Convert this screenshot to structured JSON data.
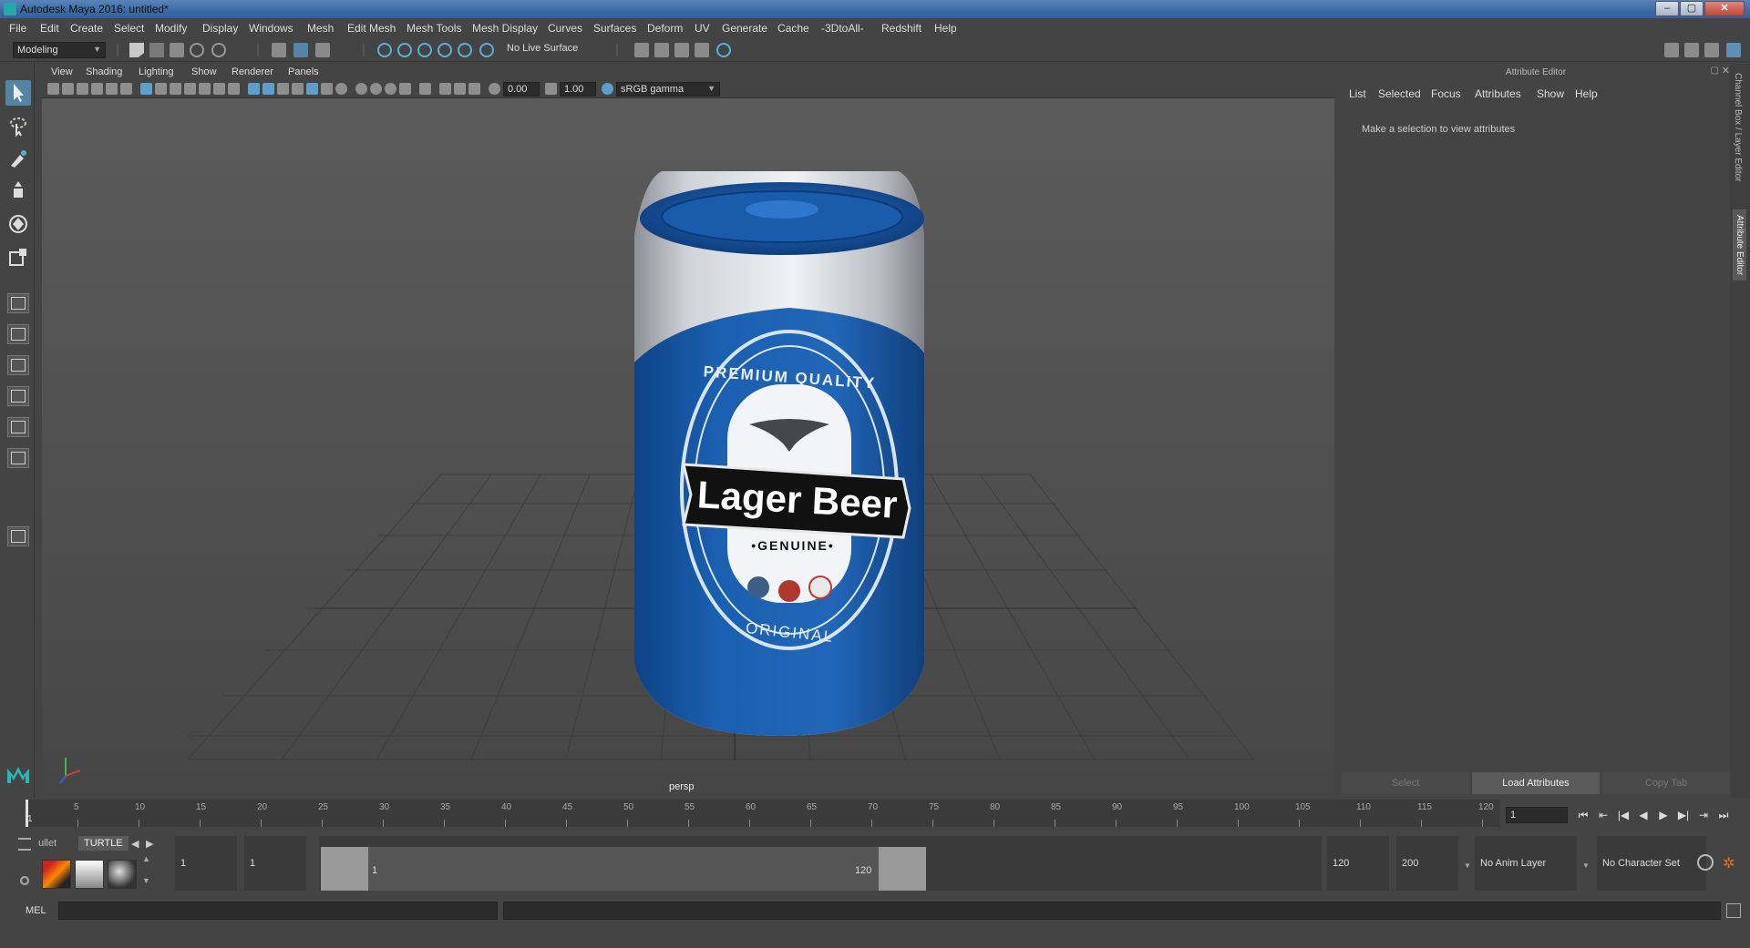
{
  "window": {
    "title": "Autodesk Maya 2016: untitled*",
    "controls": [
      "–",
      "▢",
      "✕"
    ]
  },
  "menubar": [
    "File",
    "Edit",
    "Create",
    "Select",
    "Modify",
    "Display",
    "Windows",
    "Mesh",
    "Edit Mesh",
    "Mesh Tools",
    "Mesh Display",
    "Curves",
    "Surfaces",
    "Deform",
    "UV",
    "Generate",
    "Cache",
    "-3DtoAll-",
    "Redshift",
    "Help"
  ],
  "statusline": {
    "mode": "Modeling",
    "live_surface": "No Live Surface"
  },
  "viewport": {
    "menu": [
      "View",
      "Shading",
      "Lighting",
      "Show",
      "Renderer",
      "Panels"
    ],
    "exposure": "0.00",
    "gamma": "1.00",
    "color_space": "sRGB gamma",
    "camera": "persp",
    "can": {
      "top_text": "PREMIUM QUALITY",
      "brand": "Lager Beer",
      "sub": "•GENUINE•",
      "bottom_text": "ORIGINAL",
      "colors": {
        "blue": "#1b5fb0",
        "silver": "#c9cdd2"
      }
    }
  },
  "attribute_editor": {
    "title": "Attribute Editor",
    "menu": [
      "List",
      "Selected",
      "Focus",
      "Attributes",
      "Show",
      "Help"
    ],
    "message": "Make a selection to view attributes",
    "buttons": {
      "select": "Select",
      "load": "Load Attributes",
      "copy": "Copy Tab"
    },
    "side_tabs": [
      "Channel Box / Layer Editor",
      "Attribute Editor"
    ]
  },
  "timeslider": {
    "ticks": [
      "5",
      "10",
      "15",
      "20",
      "25",
      "30",
      "35",
      "40",
      "45",
      "50",
      "55",
      "60",
      "65",
      "70",
      "75",
      "80",
      "85",
      "90",
      "95",
      "100",
      "105",
      "110",
      "115",
      "120"
    ],
    "start_label": "1",
    "current_frame": "1",
    "playback": [
      "⏮",
      "⇤",
      "|◀",
      "◀",
      "▶",
      "▶|",
      "⇥",
      "⏭"
    ]
  },
  "rangeslider": {
    "shelf_tabs": [
      "ullet",
      "TURTLE"
    ],
    "start": "1",
    "playback_start": "1",
    "range_start_label": "1",
    "range_end_label": "120",
    "playback_end": "120",
    "end": "200",
    "anim_layer": "No Anim Layer",
    "character_set": "No Character Set"
  },
  "cmdline": {
    "label": "MEL"
  }
}
